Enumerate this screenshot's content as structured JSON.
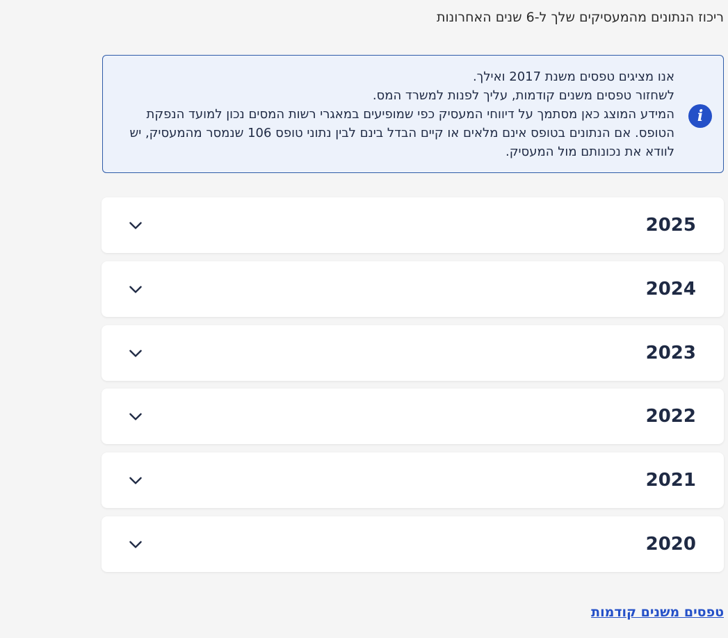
{
  "intro_text": "ריכוז הנתונים מהמעסיקים שלך ל-6 שנים האחרונות",
  "info": {
    "icon": "info-icon",
    "icon_glyph": "i",
    "lines": [
      "אנו מציגים טפסים משנת 2017 ואילך.",
      "לשחזור טפסים משנים קודמות, עליך לפנות למשרד המס.",
      "המידע המוצג כאן מסתמך על דיווחי המעסיק כפי שמופיעים במאגרי רשות המסים נכון למועד הנפקת הטופס. אם הנתונים בטופס אינם מלאים או קיים הבדל בינם לבין נתוני טופס 106 שנמסר מהמעסיק, יש לוודא את נכונותם מול המעסיק."
    ]
  },
  "years": [
    {
      "label": "2025",
      "icon": "chevron-down-icon"
    },
    {
      "label": "2024",
      "icon": "chevron-down-icon"
    },
    {
      "label": "2023",
      "icon": "chevron-down-icon"
    },
    {
      "label": "2022",
      "icon": "chevron-down-icon"
    },
    {
      "label": "2021",
      "icon": "chevron-down-icon"
    },
    {
      "label": "2020",
      "icon": "chevron-down-icon"
    }
  ],
  "previous_years_link": "טפסים משנים קודמות",
  "colors": {
    "accent": "#2450c8",
    "info_background": "#edf2fb",
    "info_border": "#2e5ba8",
    "text_dark": "#1f2a44",
    "page_background": "#f5f5f5"
  }
}
